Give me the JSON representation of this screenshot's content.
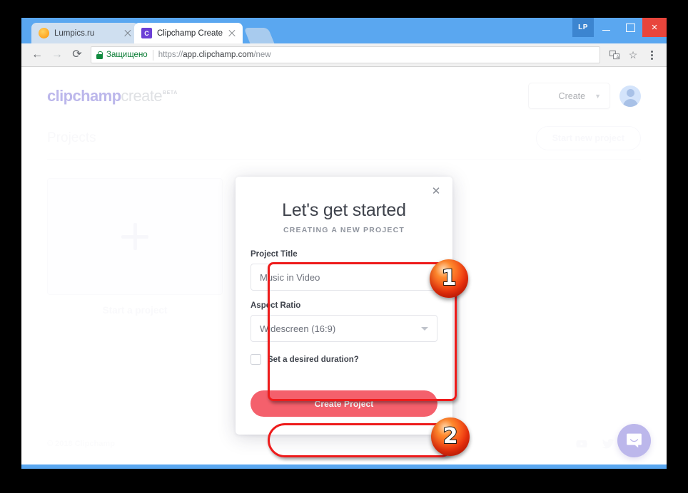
{
  "browser": {
    "tabs": [
      {
        "title": "Lumpics.ru",
        "favicon": "lumpics-favicon",
        "active": false
      },
      {
        "title": "Clipchamp Create",
        "favicon": "clipchamp-favicon",
        "active": true
      }
    ],
    "new_tab_label": "",
    "caption": {
      "lp_badge": "LP",
      "minimize_label": "",
      "maximize_label": "",
      "close_label": "×"
    },
    "toolbar": {
      "back_label": "←",
      "forward_label": "→",
      "reload_label": "⟳",
      "secure_label": "Защищено",
      "url_scheme": "https://",
      "url_host": "app.clipchamp.com",
      "url_path": "/new",
      "translate_icon_label": "⇆",
      "bookmark_star": "☆",
      "menu_label": ""
    }
  },
  "app": {
    "logo": {
      "bold_part": "clipchamp",
      "light_part": "create",
      "beta": "BETA"
    },
    "header": {
      "create_button_label": "Create",
      "create_chevron": "⌄",
      "avatar_label": ""
    },
    "projects": {
      "heading": "Projects",
      "start_new_button": "Start new project",
      "card_plus": "+",
      "card_label": "Start a project"
    },
    "footer": {
      "copyright": "© 2018 Clipchamp",
      "socials": [
        "youtube-icon",
        "twitter-icon",
        "facebook-icon"
      ],
      "chat_label": ""
    }
  },
  "modal": {
    "close_label": "✕",
    "title": "Let's get started",
    "subtitle": "CREATING A NEW PROJECT",
    "fields": {
      "project_title_label": "Project Title",
      "project_title_value": "Music in Video",
      "project_title_placeholder": "Project Title",
      "aspect_ratio_label": "Aspect Ratio",
      "aspect_ratio_value": "Widescreen (16:9)",
      "duration_checkbox_label": "Set a desired duration?",
      "duration_checked": false
    },
    "submit_label": "Create Project"
  },
  "annotations": {
    "badge_one": "1",
    "badge_two": "2",
    "highlight_color": "#ee1b1b"
  },
  "colors": {
    "chrome_blue": "#5aa7f0",
    "brand_purple": "#6a5fd3",
    "accent_pink": "#f4606c",
    "secure_green": "#0b7c35",
    "close_red": "#e8453c"
  }
}
